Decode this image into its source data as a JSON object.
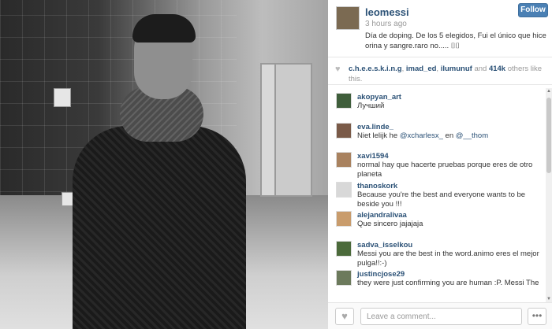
{
  "post": {
    "username": "leomessi",
    "time": "3 hours ago",
    "caption": "Día de doping. De los 5 elegidos, Fui el único que hice orina y sangre.raro no..... ⌷⌷",
    "follow_label": "Follow"
  },
  "likes": {
    "names": [
      "c.h.e.e.s.k.i.n.g",
      "imad_ed",
      "ilumunuf"
    ],
    "and_text": " and ",
    "count": "414k",
    "suffix": " others like this."
  },
  "comments": [
    {
      "user": "akopyan_art",
      "text": "Лучший",
      "avatar_color": "#3f5e3b"
    },
    {
      "user": "eva.linde_",
      "text_before": "Niet lelijk he ",
      "mention1": "@xcharlesx_",
      "middle": " en ",
      "mention2": "@__thom",
      "avatar_color": "#7a5a48"
    },
    {
      "user": "xavi1594",
      "text": "normal hay que hacerte pruebas porque eres de otro planeta",
      "avatar_color": "#a9825f"
    },
    {
      "user": "thanoskork",
      "text": "Because you're the best and everyone wants to be beside you !!!",
      "avatar_color": "#d8d8d8"
    },
    {
      "user": "alejandralivaa",
      "text": "Que sincero jajajaja",
      "avatar_color": "#c99c6c"
    },
    {
      "user": "sadva_isselkou",
      "text": "Messi you are the best in the word.animo eres el mejor pulga!!:-)",
      "avatar_color": "#4b6a3b"
    },
    {
      "user": "justincjose29",
      "text": "they were just confirming you are human :P. Messi The",
      "avatar_color": "#6c7a5c"
    }
  ],
  "footer": {
    "placeholder": "Leave a comment...",
    "like_icon": "heart-icon",
    "more_icon": "ellipsis-icon"
  }
}
